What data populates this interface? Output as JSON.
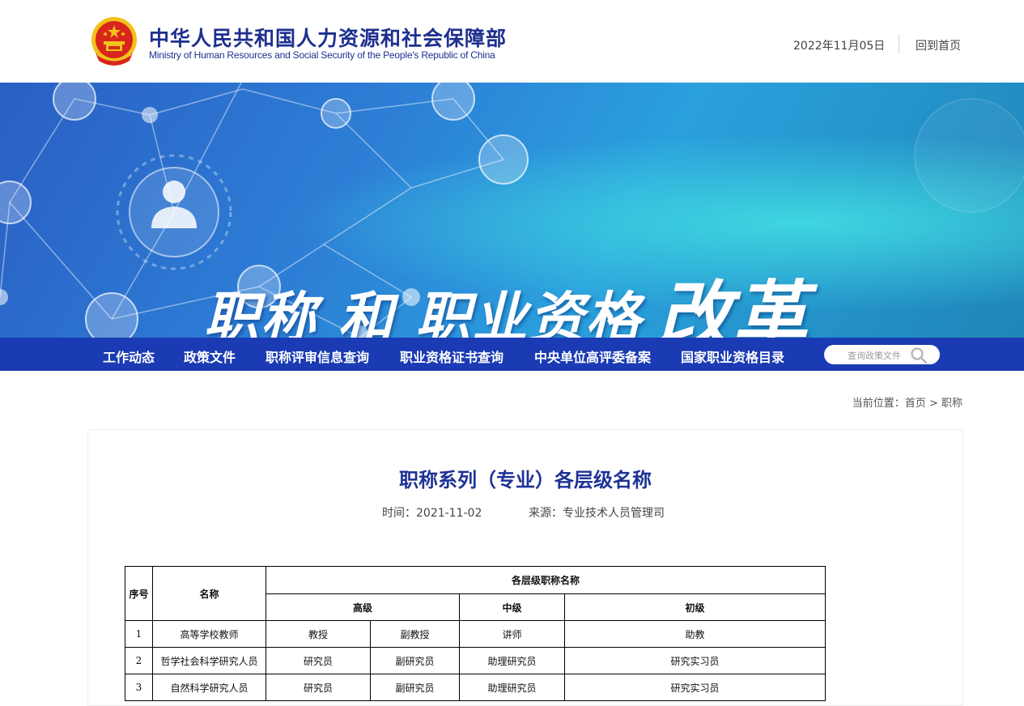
{
  "header": {
    "title_cn": "中华人民共和国人力资源和社会保障部",
    "title_en": "Ministry of Human Resources and Social Security of the People's Republic of China",
    "date": "2022年11月05日",
    "home_link": "回到首页",
    "emblem_icon": "national-emblem-icon"
  },
  "banner": {
    "text_main": "职称 和 职业资格",
    "text_big": "改革"
  },
  "nav": {
    "items": [
      "工作动态",
      "政策文件",
      "职称评审信息查询",
      "职业资格证书查询",
      "中央单位高评委备案",
      "国家职业资格目录"
    ],
    "search_placeholder": "查询政策文件",
    "search_icon": "search-icon"
  },
  "breadcrumb": {
    "prefix": "当前位置：",
    "home": "首页",
    "separator": ">",
    "current": "职称"
  },
  "article": {
    "title": "职称系列（专业）各层级名称",
    "time_label": "时间：",
    "time": "2021-11-02",
    "source_label": "来源：",
    "source": "专业技术人员管理司"
  },
  "table": {
    "header": {
      "index": "序号",
      "name": "名称",
      "levels": "各层级职称名称",
      "senior": "高级",
      "intermediate": "中级",
      "junior": "初级"
    },
    "rows": [
      {
        "index": "1",
        "name": "高等学校教师",
        "senior1": "教授",
        "senior2": "副教授",
        "intermediate": "讲师",
        "junior": "助教"
      },
      {
        "index": "2",
        "name": "哲学社会科学研究人员",
        "senior1": "研究员",
        "senior2": "副研究员",
        "intermediate": "助理研究员",
        "junior": "研究实习员"
      },
      {
        "index": "3",
        "name": "自然科学研究人员",
        "senior1": "研究员",
        "senior2": "副研究员",
        "intermediate": "助理研究员",
        "junior": "研究实习员"
      }
    ]
  },
  "colors": {
    "nav_bg": "#1a3bb3",
    "title_blue": "#1e3296",
    "emblem_red": "#d8261c",
    "emblem_gold": "#f2c21a"
  }
}
